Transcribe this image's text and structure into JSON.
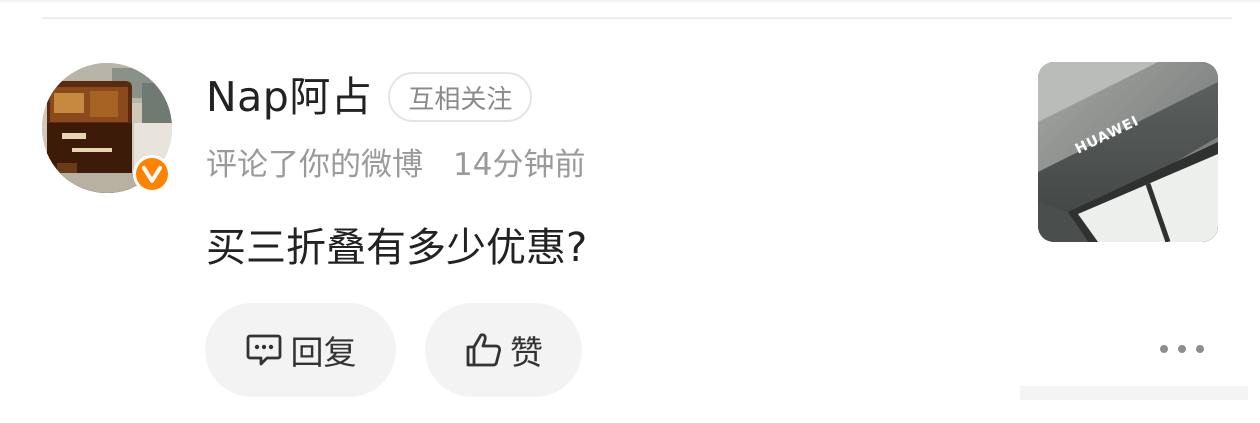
{
  "comment": {
    "user": {
      "name": "Nap阿占",
      "relationship_badge": "互相关注",
      "verified": true,
      "verified_color": "#ff8200"
    },
    "action_text": "评论了你的微博",
    "time_ago": "14分钟前",
    "text": "买三折叠有多少优惠?",
    "thumbnail": {
      "icon": "huawei-ceiling-photo",
      "brand_text": "HUAWEI"
    },
    "actions": {
      "reply_label": "回复",
      "reply_icon": "comment-bubble-icon",
      "like_label": "赞",
      "like_icon": "thumbs-up-icon",
      "more_icon": "more-dots-icon"
    }
  }
}
